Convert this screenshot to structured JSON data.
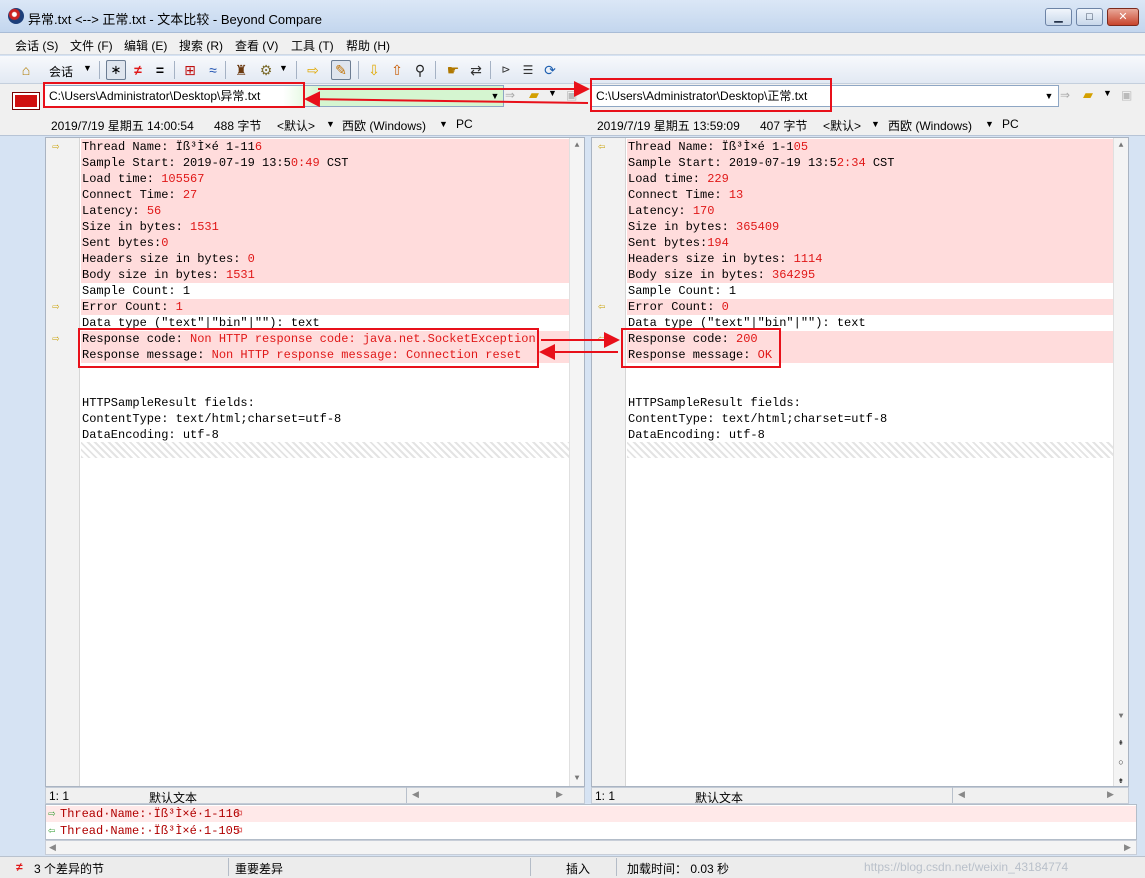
{
  "window": {
    "title": "异常.txt <--> 正常.txt - 文本比较 - Beyond Compare",
    "min_label": "▁",
    "max_label": "□",
    "close_label": "✕"
  },
  "menu": [
    "会话 (S)",
    "文件 (F)",
    "编辑 (E)",
    "搜索 (R)",
    "查看 (V)",
    "工具 (T)",
    "帮助 (H)"
  ],
  "toolbar": {
    "session_label": "会话",
    "icons": [
      "home-icon",
      "show-all-icon",
      "show-diff-icon",
      "show-same-icon",
      "context-icon",
      "ignore-minor-icon",
      "rules-icon",
      "format-icon",
      "swap-icon",
      "edit-icon",
      "next-diff-icon",
      "prev-diff-icon",
      "find-icon",
      "copy-to-right-icon",
      "swap-sides-icon",
      "align-icon",
      "select-icon",
      "refresh-icon"
    ]
  },
  "left": {
    "path": "C:\\Users\\Administrator\\Desktop\\异常.txt",
    "datetime": "2019/7/19 星期五 14:00:54",
    "size": "488 字节",
    "format_default": "<默认>",
    "encoding": "西欧 (Windows)",
    "line_ending": "PC",
    "cursor": "1: 1",
    "text_type": "默认文本"
  },
  "right": {
    "path": "C:\\Users\\Administrator\\Desktop\\正常.txt",
    "datetime": "2019/7/19 星期五 13:59:09",
    "size": "407 字节",
    "format_default": "<默认>",
    "encoding": "西欧 (Windows)",
    "line_ending": "PC",
    "cursor": "1: 1",
    "text_type": "默认文本"
  },
  "left_lines": [
    {
      "pre": "Thread Name: Ïß³Ì×é 1-11",
      "red": "6",
      "post": "",
      "diff": true,
      "arrow": true
    },
    {
      "pre": "Sample Start: 2019-07-19 13:5",
      "red": "0:49",
      "post": " CST",
      "diff": true
    },
    {
      "pre": "Load time: ",
      "red": "105567",
      "post": "",
      "diff": true
    },
    {
      "pre": "Connect Time: ",
      "red": "27",
      "post": "",
      "diff": true
    },
    {
      "pre": "Latency: ",
      "red": "56",
      "post": "",
      "diff": true
    },
    {
      "pre": "Size in bytes: ",
      "red": "1531",
      "post": "",
      "diff": true
    },
    {
      "pre": "Sent bytes:",
      "red": "0",
      "post": "",
      "diff": true
    },
    {
      "pre": "Headers size in bytes: ",
      "red": "0",
      "post": "",
      "diff": true
    },
    {
      "pre": "Body size in bytes: ",
      "red": "1531",
      "post": "",
      "diff": true
    },
    {
      "pre": "Sample Count: 1",
      "red": "",
      "post": "",
      "diff": false
    },
    {
      "pre": "Error Count: ",
      "red": "1",
      "post": "",
      "diff": true,
      "arrow": true
    },
    {
      "pre": "Data type (\"text\"|\"bin\"|\"\"): text",
      "red": "",
      "post": "",
      "diff": false
    },
    {
      "pre": "Response code: ",
      "red": "Non HTTP response code: java.net.SocketException",
      "post": "",
      "diff": true,
      "arrow": true
    },
    {
      "pre": "Response message: ",
      "red": "Non HTTP response message: Connection reset",
      "post": "",
      "diff": true
    },
    {
      "pre": "",
      "red": "",
      "post": "",
      "diff": false
    },
    {
      "pre": "",
      "red": "",
      "post": "",
      "diff": false
    },
    {
      "pre": "HTTPSampleResult fields:",
      "red": "",
      "post": "",
      "diff": false
    },
    {
      "pre": "ContentType: text/html;charset=utf-8",
      "red": "",
      "post": "",
      "diff": false
    },
    {
      "pre": "DataEncoding: utf-8",
      "red": "",
      "post": "",
      "diff": false
    }
  ],
  "right_lines": [
    {
      "pre": "Thread Name: Ïß³Ì×é 1-1",
      "red": "05",
      "post": "",
      "diff": true,
      "arrow": true
    },
    {
      "pre": "Sample Start: 2019-07-19 13:5",
      "red": "2:34",
      "post": " CST",
      "diff": true
    },
    {
      "pre": "Load time: ",
      "red": "229",
      "post": "",
      "diff": true
    },
    {
      "pre": "Connect Time: ",
      "red": "13",
      "post": "",
      "diff": true
    },
    {
      "pre": "Latency: ",
      "red": "170",
      "post": "",
      "diff": true
    },
    {
      "pre": "Size in bytes: ",
      "red": "365409",
      "post": "",
      "diff": true
    },
    {
      "pre": "Sent bytes:",
      "red": "194",
      "post": "",
      "diff": true
    },
    {
      "pre": "Headers size in bytes: ",
      "red": "1114",
      "post": "",
      "diff": true
    },
    {
      "pre": "Body size in bytes: ",
      "red": "364295",
      "post": "",
      "diff": true
    },
    {
      "pre": "Sample Count: 1",
      "red": "",
      "post": "",
      "diff": false
    },
    {
      "pre": "Error Count: ",
      "red": "0",
      "post": "",
      "diff": true,
      "arrow": true
    },
    {
      "pre": "Data type (\"text\"|\"bin\"|\"\"): text",
      "red": "",
      "post": "",
      "diff": false
    },
    {
      "pre": "Response code: ",
      "red": "200",
      "post": "",
      "diff": true,
      "arrow": true
    },
    {
      "pre": "Response message: ",
      "red": "OK",
      "post": "",
      "diff": true
    },
    {
      "pre": "",
      "red": "",
      "post": "",
      "diff": false
    },
    {
      "pre": "",
      "red": "",
      "post": "",
      "diff": false
    },
    {
      "pre": "HTTPSampleResult fields:",
      "red": "",
      "post": "",
      "diff": false
    },
    {
      "pre": "ContentType: text/html;charset=utf-8",
      "red": "",
      "post": "",
      "diff": false
    },
    {
      "pre": "DataEncoding: utf-8",
      "red": "",
      "post": "",
      "diff": false
    }
  ],
  "compare_lines": {
    "left": "Thread·Name:·Ïß³Ì×é·1-116",
    "left_end": "¤",
    "right": "Thread·Name:·Ïß³Ì×é·1-105",
    "right_end": "¤"
  },
  "status": {
    "diff_count": "3 个差异的节",
    "important": "重要差异",
    "mode": "插入",
    "load_time": "加载时间： 0.03 秒",
    "watermark": "https://blog.csdn.net/weixin_43184774"
  },
  "colors": {
    "diff_bg": "#ffdcdc",
    "diff_text": "#e01818",
    "annotation": "#e8101a"
  }
}
